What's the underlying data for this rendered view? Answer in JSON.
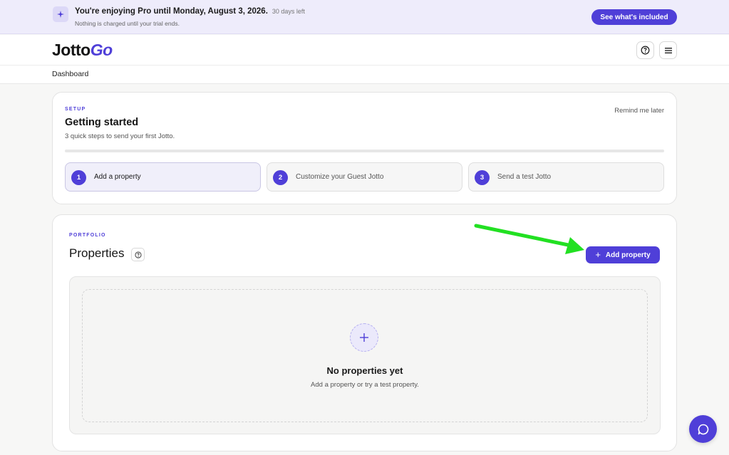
{
  "banner": {
    "title": "You're enjoying Pro until Monday, August 3, 2026.",
    "days_left": "30 days left",
    "subtitle": "Nothing is charged until your trial ends.",
    "cta_label": "See what's included"
  },
  "header": {
    "logo_main": "Jotto",
    "logo_accent": "Go"
  },
  "breadcrumb": {
    "label": "Dashboard"
  },
  "setup": {
    "eyebrow": "SETUP",
    "title": "Getting started",
    "subtitle": "3 quick steps to send your first Jotto.",
    "remind_label": "Remind me later",
    "progress": 0,
    "steps": [
      {
        "number": "1",
        "label": "Add a property"
      },
      {
        "number": "2",
        "label": "Customize your Guest Jotto"
      },
      {
        "number": "3",
        "label": "Send a test Jotto"
      }
    ]
  },
  "portfolio": {
    "eyebrow": "PORTFOLIO",
    "title": "Properties",
    "add_button_plus": "+",
    "add_button_label": "Add property",
    "empty_title": "No properties yet",
    "empty_subtitle": "Add a property or try a test property."
  },
  "icons": {
    "banner": "sparkles-icon",
    "help": "help-circle-icon",
    "menu": "menu-icon",
    "empty_add": "plus-icon",
    "chat": "chat-bubble-icon",
    "annotation": "green-arrow"
  },
  "colors": {
    "accent": "#4f3fd8",
    "banner_bg": "#eeecfb",
    "annotation_arrow": "#22e022"
  }
}
